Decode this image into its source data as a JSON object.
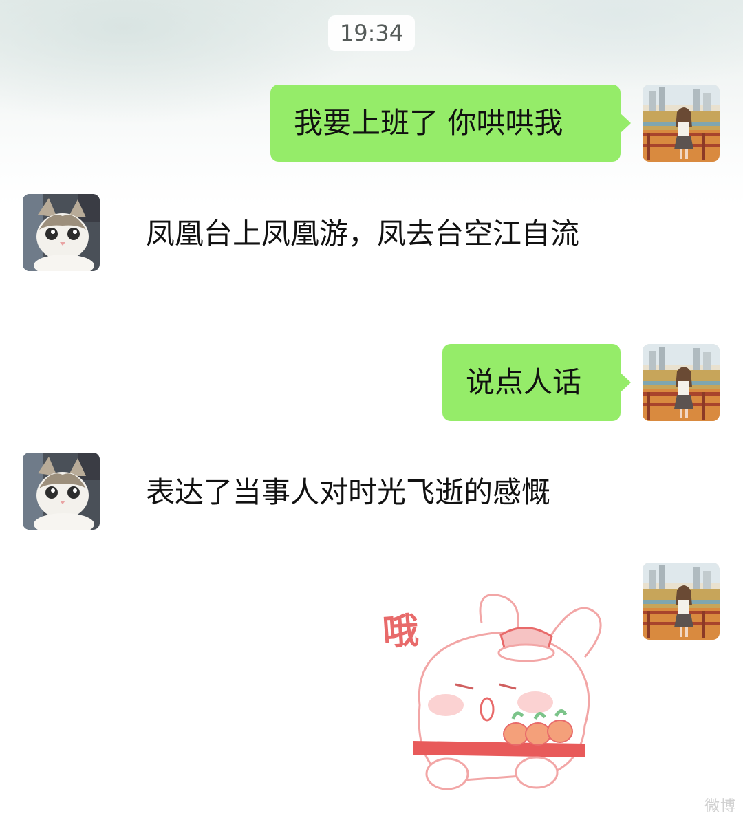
{
  "chat": {
    "timestamp": "19:34",
    "messages": [
      {
        "sender": "me",
        "type": "text",
        "text": "我要上班了 你哄哄我"
      },
      {
        "sender": "other",
        "type": "text",
        "text": "凤凰台上凤凰游，凤去台空江自流"
      },
      {
        "sender": "me",
        "type": "text",
        "text": "说点人话"
      },
      {
        "sender": "other",
        "type": "text",
        "text": "表达了当事人对时光飞逝的感慨"
      },
      {
        "sender": "me",
        "type": "sticker",
        "text": "哦"
      }
    ]
  },
  "avatars": {
    "me": "illustrated-girl-cityscape",
    "other": "cat-photo"
  },
  "watermark": {
    "text": "微博"
  },
  "colors": {
    "out_bubble": "#95ec69",
    "timestamp_bg": "#ffffff",
    "sticker_line": "#e86a6a"
  }
}
